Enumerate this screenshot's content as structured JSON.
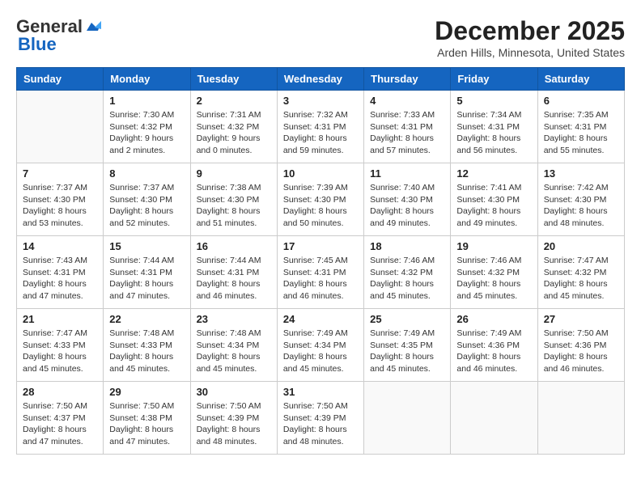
{
  "header": {
    "logo_general": "General",
    "logo_blue": "Blue",
    "month_title": "December 2025",
    "location": "Arden Hills, Minnesota, United States"
  },
  "days_of_week": [
    "Sunday",
    "Monday",
    "Tuesday",
    "Wednesday",
    "Thursday",
    "Friday",
    "Saturday"
  ],
  "weeks": [
    [
      {
        "day": "",
        "info": ""
      },
      {
        "day": "1",
        "info": "Sunrise: 7:30 AM\nSunset: 4:32 PM\nDaylight: 9 hours\nand 2 minutes."
      },
      {
        "day": "2",
        "info": "Sunrise: 7:31 AM\nSunset: 4:32 PM\nDaylight: 9 hours\nand 0 minutes."
      },
      {
        "day": "3",
        "info": "Sunrise: 7:32 AM\nSunset: 4:31 PM\nDaylight: 8 hours\nand 59 minutes."
      },
      {
        "day": "4",
        "info": "Sunrise: 7:33 AM\nSunset: 4:31 PM\nDaylight: 8 hours\nand 57 minutes."
      },
      {
        "day": "5",
        "info": "Sunrise: 7:34 AM\nSunset: 4:31 PM\nDaylight: 8 hours\nand 56 minutes."
      },
      {
        "day": "6",
        "info": "Sunrise: 7:35 AM\nSunset: 4:31 PM\nDaylight: 8 hours\nand 55 minutes."
      }
    ],
    [
      {
        "day": "7",
        "info": "Sunrise: 7:37 AM\nSunset: 4:30 PM\nDaylight: 8 hours\nand 53 minutes."
      },
      {
        "day": "8",
        "info": "Sunrise: 7:37 AM\nSunset: 4:30 PM\nDaylight: 8 hours\nand 52 minutes."
      },
      {
        "day": "9",
        "info": "Sunrise: 7:38 AM\nSunset: 4:30 PM\nDaylight: 8 hours\nand 51 minutes."
      },
      {
        "day": "10",
        "info": "Sunrise: 7:39 AM\nSunset: 4:30 PM\nDaylight: 8 hours\nand 50 minutes."
      },
      {
        "day": "11",
        "info": "Sunrise: 7:40 AM\nSunset: 4:30 PM\nDaylight: 8 hours\nand 49 minutes."
      },
      {
        "day": "12",
        "info": "Sunrise: 7:41 AM\nSunset: 4:30 PM\nDaylight: 8 hours\nand 49 minutes."
      },
      {
        "day": "13",
        "info": "Sunrise: 7:42 AM\nSunset: 4:30 PM\nDaylight: 8 hours\nand 48 minutes."
      }
    ],
    [
      {
        "day": "14",
        "info": "Sunrise: 7:43 AM\nSunset: 4:31 PM\nDaylight: 8 hours\nand 47 minutes."
      },
      {
        "day": "15",
        "info": "Sunrise: 7:44 AM\nSunset: 4:31 PM\nDaylight: 8 hours\nand 47 minutes."
      },
      {
        "day": "16",
        "info": "Sunrise: 7:44 AM\nSunset: 4:31 PM\nDaylight: 8 hours\nand 46 minutes."
      },
      {
        "day": "17",
        "info": "Sunrise: 7:45 AM\nSunset: 4:31 PM\nDaylight: 8 hours\nand 46 minutes."
      },
      {
        "day": "18",
        "info": "Sunrise: 7:46 AM\nSunset: 4:32 PM\nDaylight: 8 hours\nand 45 minutes."
      },
      {
        "day": "19",
        "info": "Sunrise: 7:46 AM\nSunset: 4:32 PM\nDaylight: 8 hours\nand 45 minutes."
      },
      {
        "day": "20",
        "info": "Sunrise: 7:47 AM\nSunset: 4:32 PM\nDaylight: 8 hours\nand 45 minutes."
      }
    ],
    [
      {
        "day": "21",
        "info": "Sunrise: 7:47 AM\nSunset: 4:33 PM\nDaylight: 8 hours\nand 45 minutes."
      },
      {
        "day": "22",
        "info": "Sunrise: 7:48 AM\nSunset: 4:33 PM\nDaylight: 8 hours\nand 45 minutes."
      },
      {
        "day": "23",
        "info": "Sunrise: 7:48 AM\nSunset: 4:34 PM\nDaylight: 8 hours\nand 45 minutes."
      },
      {
        "day": "24",
        "info": "Sunrise: 7:49 AM\nSunset: 4:34 PM\nDaylight: 8 hours\nand 45 minutes."
      },
      {
        "day": "25",
        "info": "Sunrise: 7:49 AM\nSunset: 4:35 PM\nDaylight: 8 hours\nand 45 minutes."
      },
      {
        "day": "26",
        "info": "Sunrise: 7:49 AM\nSunset: 4:36 PM\nDaylight: 8 hours\nand 46 minutes."
      },
      {
        "day": "27",
        "info": "Sunrise: 7:50 AM\nSunset: 4:36 PM\nDaylight: 8 hours\nand 46 minutes."
      }
    ],
    [
      {
        "day": "28",
        "info": "Sunrise: 7:50 AM\nSunset: 4:37 PM\nDaylight: 8 hours\nand 47 minutes."
      },
      {
        "day": "29",
        "info": "Sunrise: 7:50 AM\nSunset: 4:38 PM\nDaylight: 8 hours\nand 47 minutes."
      },
      {
        "day": "30",
        "info": "Sunrise: 7:50 AM\nSunset: 4:39 PM\nDaylight: 8 hours\nand 48 minutes."
      },
      {
        "day": "31",
        "info": "Sunrise: 7:50 AM\nSunset: 4:39 PM\nDaylight: 8 hours\nand 48 minutes."
      },
      {
        "day": "",
        "info": ""
      },
      {
        "day": "",
        "info": ""
      },
      {
        "day": "",
        "info": ""
      }
    ]
  ]
}
